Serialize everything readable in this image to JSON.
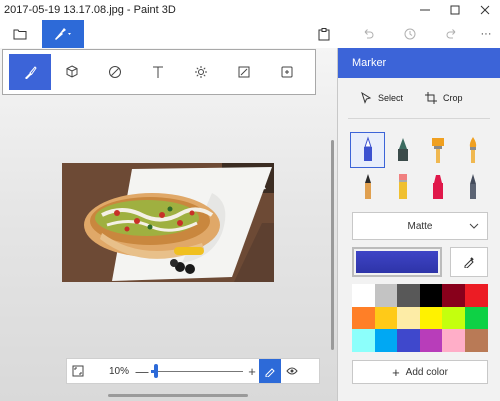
{
  "window": {
    "title": "2017-05-19 13.17.08.jpg - Paint 3D",
    "minimize_icon": "minimize-icon",
    "maximize_icon": "maximize-icon",
    "close_icon": "close-icon"
  },
  "toolbar": {
    "items": [
      "menu-folder-icon",
      "brushes-icon",
      "paste-icon",
      "undo-icon",
      "history-icon",
      "redo-icon",
      "more-icon"
    ],
    "more_label": "···"
  },
  "tool_tabs": [
    "brushes",
    "3d-shapes",
    "stickers",
    "text",
    "effects",
    "canvas",
    "remix-3d"
  ],
  "zoom": {
    "percent_label": "10%",
    "percent_value": 10,
    "minus_label": "—",
    "plus_label": "+"
  },
  "panel": {
    "title": "Marker",
    "select_label": "Select",
    "crop_label": "Crop",
    "brushes": [
      {
        "name": "marker",
        "color": "#3c52d0",
        "active": true
      },
      {
        "name": "calligraphy-pen",
        "color": "#3b4b4a"
      },
      {
        "name": "oil-brush",
        "color": "#f0a020"
      },
      {
        "name": "watercolor",
        "color": "#f0a020"
      },
      {
        "name": "pixel-pen",
        "color": "#e0a050"
      },
      {
        "name": "pencil",
        "color": "#f08080"
      },
      {
        "name": "eraser",
        "color": "#e0184a"
      },
      {
        "name": "crayon",
        "color": "#444c5c"
      }
    ],
    "finish": {
      "selected": "Matte"
    },
    "current_color": "#3e44c6",
    "palette": [
      "#ffffff",
      "#c3c3c3",
      "#585858",
      "#000000",
      "#88001b",
      "#ec1c24",
      "#ff7f27",
      "#ffca18",
      "#fdeca6",
      "#fff200",
      "#c4ff0e",
      "#0ed145",
      "#8cfffb",
      "#00a8f3",
      "#3f48cc",
      "#b83dba",
      "#ffaec8",
      "#b97a56"
    ],
    "add_color_label": "Add color"
  }
}
